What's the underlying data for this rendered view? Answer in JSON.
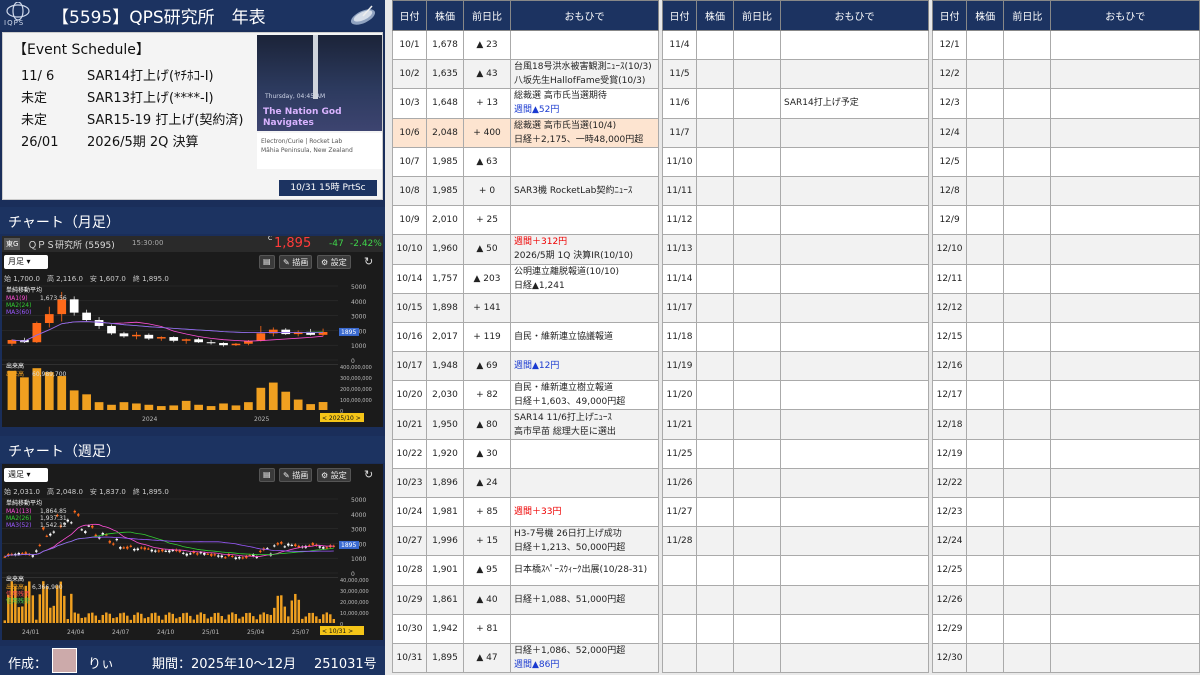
{
  "header": {
    "logo_text": "IQPS",
    "title": "【5595】QPS研究所　年表"
  },
  "events": {
    "title": "【Event Schedule】",
    "items": [
      {
        "date": "11/ 6",
        "text": "SAR14打上げ(ﾔﾁﾎｺ-Ⅰ)"
      },
      {
        "date": "未定",
        "text": "SAR13打上げ(****-Ⅰ)"
      },
      {
        "date": "未定",
        "text": "SAR15-19 打上げ(契約済)"
      },
      {
        "date": "26/01",
        "text": "2026/5期 2Q 決算"
      }
    ],
    "photo": {
      "when": "Thursday, 04:45 AM",
      "caption1": "The Nation God",
      "caption2": "Navigates",
      "info1": "Electron/Curie | Rocket Lab",
      "info2": "Māhia Peninsula, New Zealand"
    },
    "button": "10/31 15時 PrtSc"
  },
  "monthly": {
    "title": "チャート（月足）",
    "exchange": "東G",
    "name": "ＱＰＳ研究所 (5595)",
    "time": "15:30:00",
    "c": "C",
    "price": "1,895",
    "change": "-47",
    "pct": "-2.42%",
    "period": "月足",
    "draw": "描画",
    "settings": "設定",
    "ohlc": [
      "始 1,700.0",
      "高 2,116.0",
      "安 1,607.0",
      "終 1,895.0"
    ],
    "ma_title": "単純移動平均",
    "ma": [
      {
        "n": "MA1(9)",
        "v": "1,673.56",
        "color": "#ff4fd8"
      },
      {
        "n": "MA2(24)",
        "v": "",
        "color": "#33cc33"
      },
      {
        "n": "MA3(60)",
        "v": "",
        "color": "#9b59ff"
      }
    ],
    "vol_label": "出来高",
    "vol_label2": "出来高",
    "vol": "60,989,700",
    "xlabels": [
      "2024",
      "2025"
    ],
    "ylabels": [
      "5000",
      "4000",
      "3000",
      "2000",
      "1000",
      "0"
    ],
    "vlabels": [
      "400,000,000",
      "300,000,000",
      "200,000,000",
      "100,000,000",
      "0"
    ],
    "last": "1895",
    "date_tag": "< 2025/10 >",
    "candles": [
      [
        1100,
        1400,
        950,
        1350
      ],
      [
        1350,
        1500,
        1150,
        1200
      ],
      [
        1200,
        2600,
        1150,
        2500
      ],
      [
        2500,
        3600,
        2200,
        3100
      ],
      [
        3100,
        4600,
        2600,
        4100
      ],
      [
        4100,
        4300,
        3000,
        3200
      ],
      [
        3200,
        3400,
        2600,
        2700
      ],
      [
        2700,
        2900,
        2100,
        2300
      ],
      [
        2300,
        2400,
        1700,
        1800
      ],
      [
        1800,
        1900,
        1500,
        1600
      ],
      [
        1600,
        1900,
        1400,
        1700
      ],
      [
        1700,
        1800,
        1350,
        1450
      ],
      [
        1450,
        1600,
        1300,
        1550
      ],
      [
        1550,
        1600,
        1200,
        1300
      ],
      [
        1300,
        1450,
        1100,
        1400
      ],
      [
        1400,
        1500,
        1150,
        1200
      ],
      [
        1200,
        1350,
        1050,
        1150
      ],
      [
        1150,
        1200,
        900,
        1000
      ],
      [
        1000,
        1150,
        950,
        1100
      ],
      [
        1100,
        1350,
        1000,
        1300
      ],
      [
        1300,
        2300,
        1250,
        1800
      ],
      [
        1800,
        2200,
        1600,
        2050
      ],
      [
        2050,
        2150,
        1700,
        1750
      ],
      [
        1750,
        2000,
        1600,
        1900
      ],
      [
        1900,
        2100,
        1650,
        1700
      ],
      [
        1700,
        2116,
        1607,
        1895
      ]
    ],
    "volumes": [
      300,
      250,
      320,
      290,
      260,
      150,
      120,
      60,
      40,
      60,
      50,
      40,
      30,
      35,
      70,
      40,
      30,
      50,
      35,
      60,
      170,
      210,
      140,
      80,
      45,
      61
    ]
  },
  "weekly": {
    "title": "チャート（週足）",
    "period": "週足",
    "draw": "描画",
    "settings": "設定",
    "ohlc": [
      "始 2,031.0",
      "高 2,048.0",
      "安 1,837.0",
      "終 1,895.0"
    ],
    "ma_title": "単純移動平均",
    "ma": [
      {
        "n": "MA1(13)",
        "v": "1,864.85",
        "color": "#ff4fd8"
      },
      {
        "n": "MA2(26)",
        "v": "1,937.31",
        "color": "#33cc33"
      },
      {
        "n": "MA3(52)",
        "v": "1,542.12",
        "color": "#9b59ff"
      }
    ],
    "vol_label": "出来高",
    "vol": "6,366,900",
    "margin_buy": "信用残買",
    "margin_sell": "信用残売",
    "xlabels": [
      "24/01",
      "24/04",
      "24/07",
      "24/10",
      "25/01",
      "25/04",
      "25/07",
      "25/10"
    ],
    "ylabels": [
      "5000",
      "4000",
      "3000",
      "2000",
      "1000",
      "0"
    ],
    "vlabels": [
      "40,000,000",
      "30,000,000",
      "20,000,000",
      "10,000,000",
      "0"
    ],
    "last": "1895",
    "date_tag": "< 10/31 >"
  },
  "footer": {
    "author_label": "作成：",
    "author": "りぃ",
    "period": "期間：2025年10～12月",
    "issue": "251031号"
  },
  "table": {
    "headers": [
      "日付",
      "株価",
      "前日比",
      "おもひで"
    ],
    "oct": [
      {
        "d": "10/1",
        "p": "1,678",
        "ch": "▲ 23",
        "dir": "dn",
        "m1": "",
        "m2": ""
      },
      {
        "d": "10/2",
        "p": "1,635",
        "ch": "▲ 43",
        "dir": "dn",
        "m1": "台風18号洪水被害観測ﾆｭｰｽ(10/3)",
        "m2": "八坂先生HallofFame受賞(10/3)"
      },
      {
        "d": "10/3",
        "p": "1,648",
        "ch": "+ 13",
        "dir": "up",
        "m1": "総裁選 高市氏当選期待",
        "m2": "週間▲52円",
        "m2c": "blue"
      },
      {
        "d": "10/6",
        "p": "2,048",
        "ch": "+ 400",
        "dir": "up",
        "m1": "総裁選 高市氏当選(10/4)",
        "m2": "日経＋2,175、一時48,000円超",
        "hl": true
      },
      {
        "d": "10/7",
        "p": "1,985",
        "ch": "▲ 63",
        "dir": "dn",
        "m1": "",
        "m2": ""
      },
      {
        "d": "10/8",
        "p": "1,985",
        "ch": "+ 0",
        "dir": "up",
        "m1": "SAR3機 RocketLab契約ﾆｭｰｽ",
        "m2": ""
      },
      {
        "d": "10/9",
        "p": "2,010",
        "ch": "+ 25",
        "dir": "up",
        "m1": "",
        "m2": ""
      },
      {
        "d": "10/10",
        "p": "1,960",
        "ch": "▲ 50",
        "dir": "dn",
        "m1": "週間＋312円",
        "m1c": "red",
        "m2": "2026/5期 1Q 決算IR(10/10)"
      },
      {
        "d": "10/14",
        "p": "1,757",
        "ch": "▲ 203",
        "dir": "dn",
        "m1": "公明連立離脱報道(10/10)",
        "m2": "日経▲1,241"
      },
      {
        "d": "10/15",
        "p": "1,898",
        "ch": "+ 141",
        "dir": "up",
        "m1": "",
        "m2": ""
      },
      {
        "d": "10/16",
        "p": "2,017",
        "ch": "+ 119",
        "dir": "up",
        "m1": "自民・維新連立協議報道",
        "m2": ""
      },
      {
        "d": "10/17",
        "p": "1,948",
        "ch": "▲ 69",
        "dir": "dn",
        "m1": "週間▲12円",
        "m1c": "blue",
        "m2": ""
      },
      {
        "d": "10/20",
        "p": "2,030",
        "ch": "+ 82",
        "dir": "up",
        "m1": "自民・維新連立樹立報道",
        "m2": "日経＋1,603、49,000円超"
      },
      {
        "d": "10/21",
        "p": "1,950",
        "ch": "▲ 80",
        "dir": "dn",
        "m1": "SAR14 11/6打上げﾆｭｰｽ",
        "m2": "高市早苗 総理大臣に選出"
      },
      {
        "d": "10/22",
        "p": "1,920",
        "ch": "▲ 30",
        "dir": "dn",
        "m1": "",
        "m2": ""
      },
      {
        "d": "10/23",
        "p": "1,896",
        "ch": "▲ 24",
        "dir": "dn",
        "m1": "",
        "m2": ""
      },
      {
        "d": "10/24",
        "p": "1,981",
        "ch": "+ 85",
        "dir": "up",
        "m1": "週間＋33円",
        "m1c": "red",
        "m2": ""
      },
      {
        "d": "10/27",
        "p": "1,996",
        "ch": "+ 15",
        "dir": "up",
        "m1": "H3-7号機 26日打上げ成功",
        "m2": "日経＋1,213、50,000円超"
      },
      {
        "d": "10/28",
        "p": "1,901",
        "ch": "▲ 95",
        "dir": "dn",
        "m1": "日本橋ｽﾍﾟｰｽｳｨｰｸ出展(10/28-31)",
        "m2": ""
      },
      {
        "d": "10/29",
        "p": "1,861",
        "ch": "▲ 40",
        "dir": "dn",
        "m1": "日経＋1,088、51,000円超",
        "m2": ""
      },
      {
        "d": "10/30",
        "p": "1,942",
        "ch": "+ 81",
        "dir": "up",
        "m1": "",
        "m2": ""
      },
      {
        "d": "10/31",
        "p": "1,895",
        "ch": "▲ 47",
        "dir": "dn",
        "m1": "日経＋1,086、52,000円超",
        "m2": "週間▲86円",
        "m2c": "blue"
      }
    ],
    "nov": [
      "11/4",
      "11/5",
      "11/6",
      "11/7",
      "11/10",
      "11/11",
      "11/12",
      "11/13",
      "11/14",
      "11/17",
      "11/18",
      "11/19",
      "11/20",
      "11/21",
      "11/25",
      "11/26",
      "11/27",
      "11/28",
      "",
      "",
      "",
      ""
    ],
    "nov_memo": {
      "11/6": "SAR14打上げ予定"
    },
    "dec": [
      "12/1",
      "12/2",
      "12/3",
      "12/4",
      "12/5",
      "12/8",
      "12/9",
      "12/10",
      "12/11",
      "12/12",
      "12/15",
      "12/16",
      "12/17",
      "12/18",
      "12/19",
      "12/22",
      "12/23",
      "12/24",
      "12/25",
      "12/26",
      "12/29",
      "12/30"
    ]
  }
}
